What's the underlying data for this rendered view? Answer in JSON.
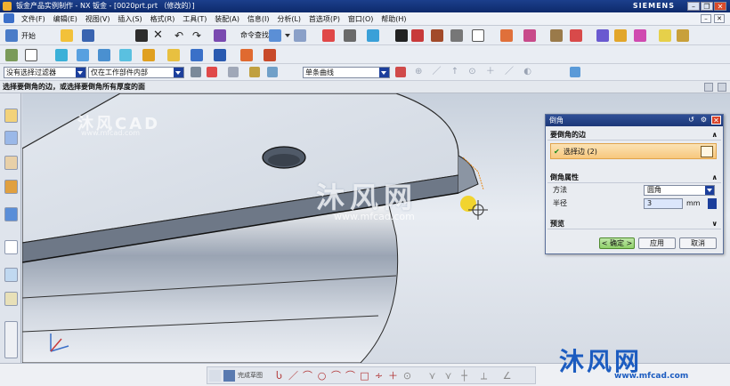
{
  "window": {
    "title": "钣金产品实例制作 - NX 钣金 - [0020prt.prt （修改的）]",
    "brand": "SIEMENS",
    "min": "–",
    "max": "❐",
    "close": "✕"
  },
  "menubar": {
    "items": [
      "文件(F)",
      "编辑(E)",
      "视图(V)",
      "插入(S)",
      "格式(R)",
      "工具(T)",
      "装配(A)",
      "信息(I)",
      "分析(L)",
      "首选项(P)",
      "窗口(O)",
      "帮助(H)"
    ],
    "restore": "–",
    "close": "✕"
  },
  "toolbar": {
    "start_label": "开始",
    "command_finder": "命令查找器"
  },
  "selection_bar": {
    "filter": "没有选择过滤器",
    "scope": "仅在工作部件内部",
    "curve_rule": "单条曲线"
  },
  "cue_line": "选择要倒角的边，或选择要倒角所有厚度的面",
  "dialog": {
    "title": "倒角",
    "group_edges": "要倒角的边",
    "select_edge": "选择边 (2)",
    "group_properties": "倒角属性",
    "method_label": "方法",
    "method_value": "圆角",
    "radius_label": "半径",
    "radius_value": "3",
    "radius_unit": "mm",
    "group_preview": "预览",
    "ok": "< 确定 >",
    "apply": "应用",
    "cancel": "取消"
  },
  "bottom": {
    "sketch_label": "完成草图"
  },
  "watermark": {
    "brand": "沐风网",
    "url": "www.mfcad.com",
    "brand_top": "沐风CAD"
  }
}
